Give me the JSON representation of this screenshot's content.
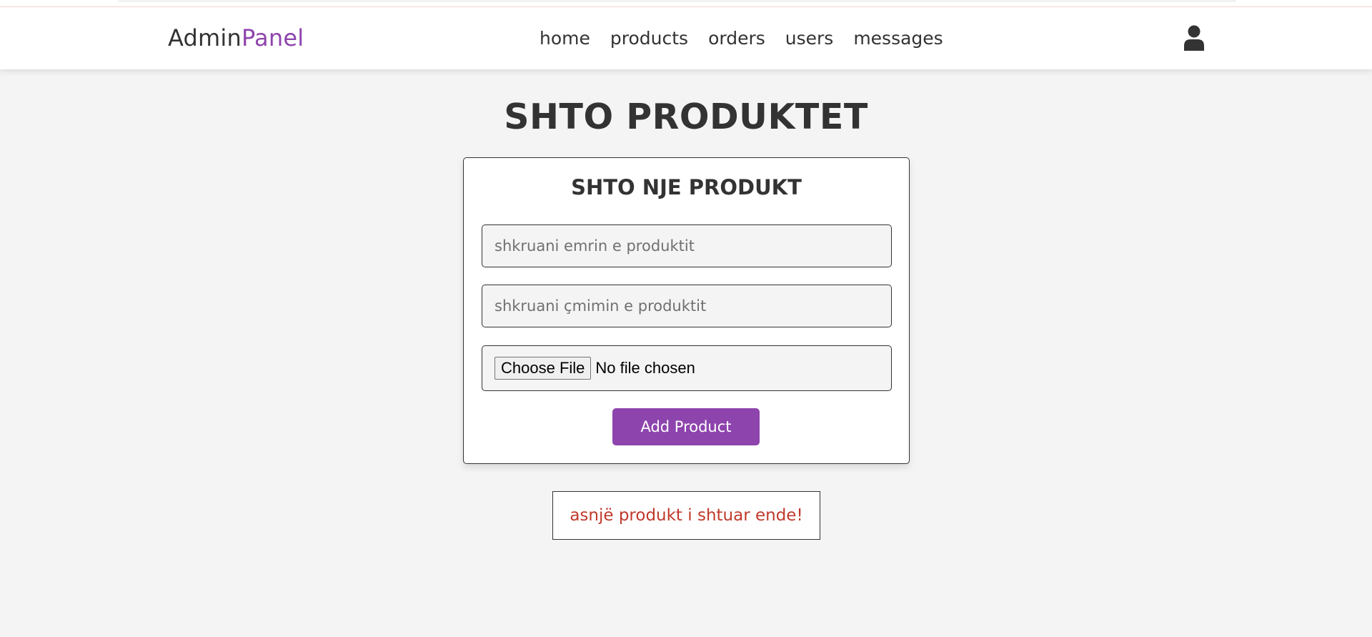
{
  "header": {
    "logo_main": "Admin",
    "logo_accent": "Panel",
    "nav": [
      {
        "label": "home"
      },
      {
        "label": "products"
      },
      {
        "label": "orders"
      },
      {
        "label": "users"
      },
      {
        "label": "messages"
      }
    ],
    "user_icon": "user-icon"
  },
  "page": {
    "title": "SHTO PRODUKTET"
  },
  "form": {
    "title": "SHTO NJE PRODUKT",
    "name_placeholder": "shkruani emrin e produktit",
    "name_value": "",
    "price_placeholder": "shkruani çmimin e produktit",
    "price_value": "",
    "file_button": "Choose File",
    "file_status": "No file chosen",
    "submit_label": "Add Product"
  },
  "empty_message": "asnjë produkt i shtuar ende!",
  "colors": {
    "accent": "#8e44ad",
    "empty_text": "#c0392b",
    "background": "#f4f4f4"
  }
}
